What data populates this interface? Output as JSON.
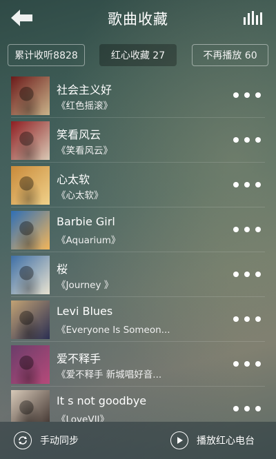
{
  "header": {
    "title": "歌曲收藏",
    "back_icon": "back-arrow-icon",
    "menu_icon": "equalizer-bars-icon"
  },
  "tabs": [
    {
      "label": "累计收听8828",
      "style": "outlined"
    },
    {
      "label": "红心收藏 27",
      "style": "active"
    },
    {
      "label": "不再播放 60",
      "style": "outlined"
    }
  ],
  "songs": [
    {
      "title": "社会主义好",
      "album": "《红色摇滚》",
      "cover_colors": [
        "#6b1a1a",
        "#c9b38a"
      ]
    },
    {
      "title": "笑看风云",
      "album": "《笑看风云》",
      "cover_colors": [
        "#8e1e22",
        "#d9c9b5"
      ]
    },
    {
      "title": "心太软",
      "album": "《心太软》",
      "cover_colors": [
        "#c98a3a",
        "#f0d18a"
      ]
    },
    {
      "title": "Barbie Girl",
      "album": "《Aquarium》",
      "cover_colors": [
        "#2f6fb6",
        "#f2b55a"
      ]
    },
    {
      "title": "桜",
      "album": "《Journey 》",
      "cover_colors": [
        "#3e6fa6",
        "#e8e2d0"
      ]
    },
    {
      "title": "Levi Blues",
      "album": "《Everyone Is Someon...",
      "cover_colors": [
        "#c2a274",
        "#2b2f52"
      ]
    },
    {
      "title": "爱不释手",
      "album": "《爱不释手 新城唱好音...",
      "cover_colors": [
        "#6b3d6a",
        "#b64a7a"
      ]
    },
    {
      "title": "It s not goodbye",
      "album": "《LoveVII》",
      "cover_colors": [
        "#d7c9b8",
        "#3a2e2a"
      ]
    }
  ],
  "footer": {
    "sync_label": "手动同步",
    "sync_icon": "sync-icon",
    "play_label": "播放红心电台",
    "play_icon": "play-icon"
  }
}
